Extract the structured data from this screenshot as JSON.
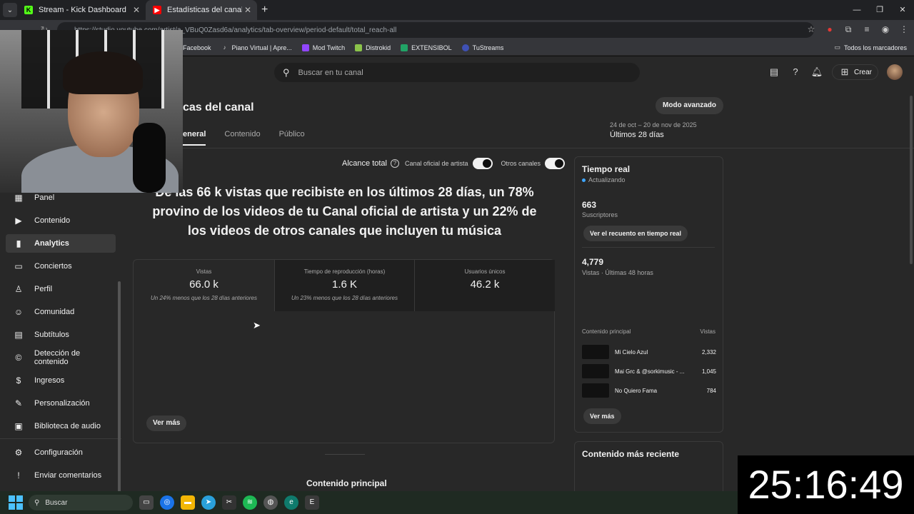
{
  "browser": {
    "tabs": [
      {
        "title": "Stream - Kick Dashboard",
        "favicon": "kick-icon",
        "color": "#53fc18"
      },
      {
        "title": "Estadísticas del canal - YouTube",
        "favicon": "youtube-studio-icon",
        "color": "#ff0000"
      }
    ],
    "url": "https://studio.youtube.com/artist/a_VBuQ0Zasd6a/analytics/tab-overview/period-default/total_reach-all",
    "bookmarks": [
      {
        "label": "Facebook",
        "icon": "facebook-icon"
      },
      {
        "label": "Piano Virtual | Apre...",
        "icon": "piano-icon"
      },
      {
        "label": "Mod Twitch",
        "icon": "twitch-icon"
      },
      {
        "label": "Distrokid",
        "icon": "distrokid-icon"
      },
      {
        "label": "EXTENSIBOL",
        "icon": "extension-icon"
      },
      {
        "label": "TuStreams",
        "icon": "tustreams-icon"
      }
    ],
    "all_bookmarks": "Todos los marcadores"
  },
  "header": {
    "search_placeholder": "Buscar en tu canal",
    "create_label": "Crear"
  },
  "sidebar": {
    "items": [
      {
        "label": "Panel",
        "icon": "dashboard-icon"
      },
      {
        "label": "Contenido",
        "icon": "content-icon"
      },
      {
        "label": "Analytics",
        "icon": "analytics-icon",
        "active": true
      },
      {
        "label": "Conciertos",
        "icon": "concerts-icon"
      },
      {
        "label": "Perfil",
        "icon": "profile-icon"
      },
      {
        "label": "Comunidad",
        "icon": "community-icon"
      },
      {
        "label": "Subtítulos",
        "icon": "subtitles-icon"
      },
      {
        "label": "Detección de contenido",
        "icon": "copyright-icon"
      },
      {
        "label": "Ingresos",
        "icon": "earn-icon"
      },
      {
        "label": "Personalización",
        "icon": "customization-icon"
      },
      {
        "label": "Biblioteca de audio",
        "icon": "audio-library-icon"
      }
    ],
    "footer": [
      {
        "label": "Configuración",
        "icon": "settings-icon"
      },
      {
        "label": "Enviar comentarios",
        "icon": "feedback-icon"
      }
    ]
  },
  "main": {
    "title": "cas del canal",
    "tabs": [
      "eneral",
      "Contenido",
      "Público"
    ],
    "advanced_mode": "Modo avanzado",
    "date_range": "24 de oct – 20 de nov de 2025",
    "date_label": "Últimos 28 días",
    "reach": {
      "title": "Alcance total",
      "toggle1": "Canal oficial de artista",
      "toggle2": "Otros canales"
    },
    "headline": "De las 66 k vistas que recibiste en los últimos 28 días, un 78% provino de los videos de tu Canal oficial de artista y un 22% de los videos de otros canales que incluyen tu música",
    "metrics": [
      {
        "label": "Vistas",
        "value": "66.0 k",
        "comparison": "Un 24% menos que los 28 días anteriores"
      },
      {
        "label": "Tiempo de reproducción (horas)",
        "value": "1.6 K",
        "comparison": "Un 23% menos que los 28 días anteriores"
      },
      {
        "label": "Usuarios únicos",
        "value": "46.2 k",
        "comparison": ""
      }
    ],
    "see_more": "Ver más",
    "section_title": "Contenido principal"
  },
  "realtime": {
    "title": "Tiempo real",
    "status": "Actualizando",
    "subscribers": "663",
    "subscribers_label": "Suscriptores",
    "realtime_button": "Ver el recuento en tiempo real",
    "views": "4,779",
    "views_label": "Vistas · Últimas 48 horas",
    "col_content": "Contenido principal",
    "col_views": "Vistas",
    "rows": [
      {
        "title": "Mi Cielo Azul",
        "views": "2,332"
      },
      {
        "title": "Mai Grc & @sorkimusic - ...",
        "views": "1,045"
      },
      {
        "title": "No Quiero Fama",
        "views": "784"
      }
    ],
    "see_more": "Ver más"
  },
  "recent": {
    "title": "Contenido más reciente"
  },
  "overlay": {
    "timer": "25:16:49"
  },
  "taskbar": {
    "search_label": "Buscar"
  }
}
